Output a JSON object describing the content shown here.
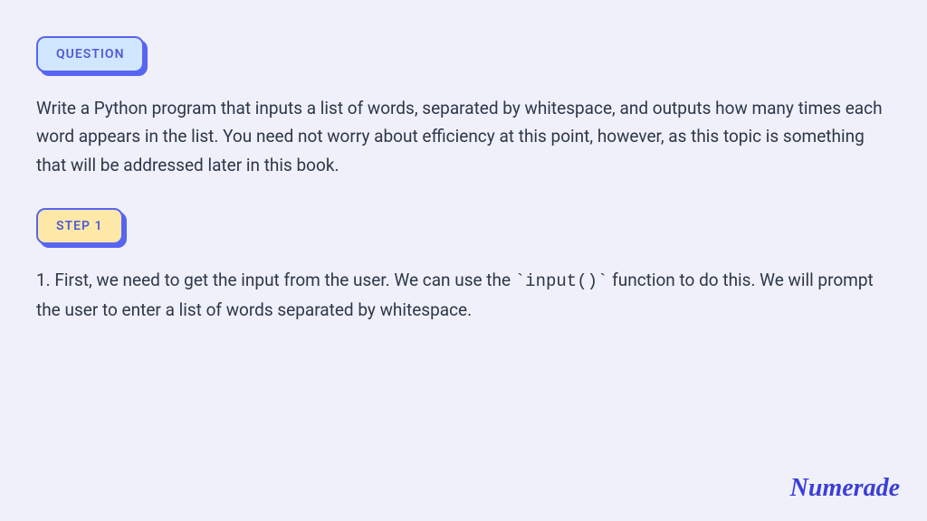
{
  "question_badge": "QUESTION",
  "question_text": "Write a Python program that inputs a list of words, separated by whitespace, and outputs how many times each word appears in the list. You need not worry about efficiency at this point, however, as this topic is something that will be addressed later in this book.",
  "step_badge": "STEP 1",
  "step_text_prefix": "1. First, we need to get the input from the user. We can use the ",
  "step_code": "`input()`",
  "step_text_suffix": " function to do this. We will prompt the user to enter a list of words separated by whitespace.",
  "logo": "Numerade"
}
